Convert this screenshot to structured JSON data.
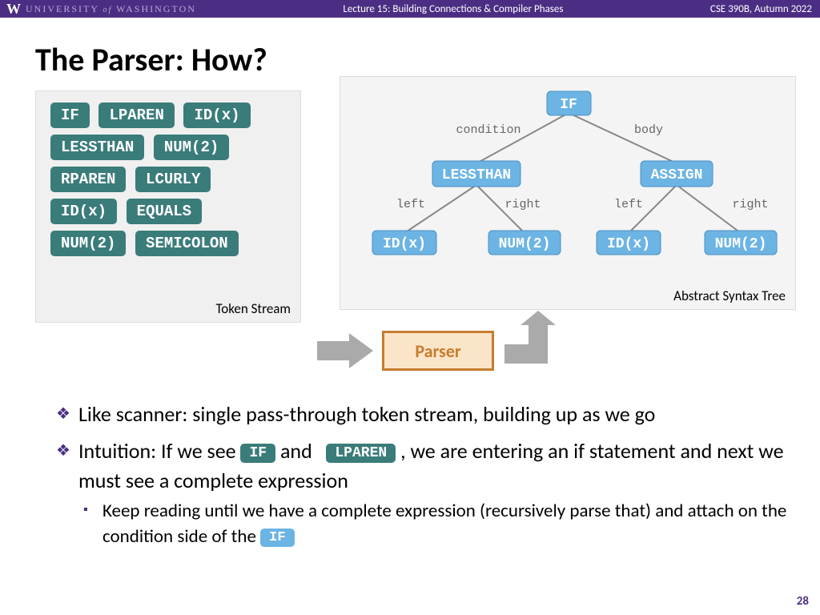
{
  "header": {
    "logo": "W",
    "university": "UNIVERSITY",
    "of": "of",
    "washington": "WASHINGTON",
    "lecture": "Lecture 15: Building Connections & Compiler Phases",
    "course": "CSE 390B, Autumn 2022"
  },
  "title": "The Parser: How?",
  "token_panel": {
    "label": "Token Stream",
    "tokens": [
      "IF",
      "LPAREN",
      "ID(x)",
      "LESSTHAN",
      "NUM(2)",
      "RPAREN",
      "LCURLY",
      "ID(x)",
      "EQUALS",
      "NUM(2)",
      "SEMICOLON"
    ]
  },
  "ast_panel": {
    "label": "Abstract Syntax Tree",
    "root": "IF",
    "edges": {
      "cond": "condition",
      "body": "body",
      "left": "left",
      "right": "right"
    },
    "nodes": {
      "lessthan": "LESSTHAN",
      "assign": "ASSIGN",
      "idx": "ID(x)",
      "num2": "NUM(2)"
    }
  },
  "parser_box": "Parser",
  "bullets": {
    "b1": "Like scanner: single pass-through token stream, building up as we go",
    "b2a": "Intuition: If we see ",
    "b2_tok1": "IF",
    "b2b": " and ",
    "b2_tok2": "LPAREN",
    "b2c": " , we are entering an if statement and next we must see a complete expression",
    "b3a": "Keep reading until we have a complete expression (recursively parse that) and attach on the condition side of the ",
    "b3_tok": "IF"
  },
  "page_number": "28"
}
